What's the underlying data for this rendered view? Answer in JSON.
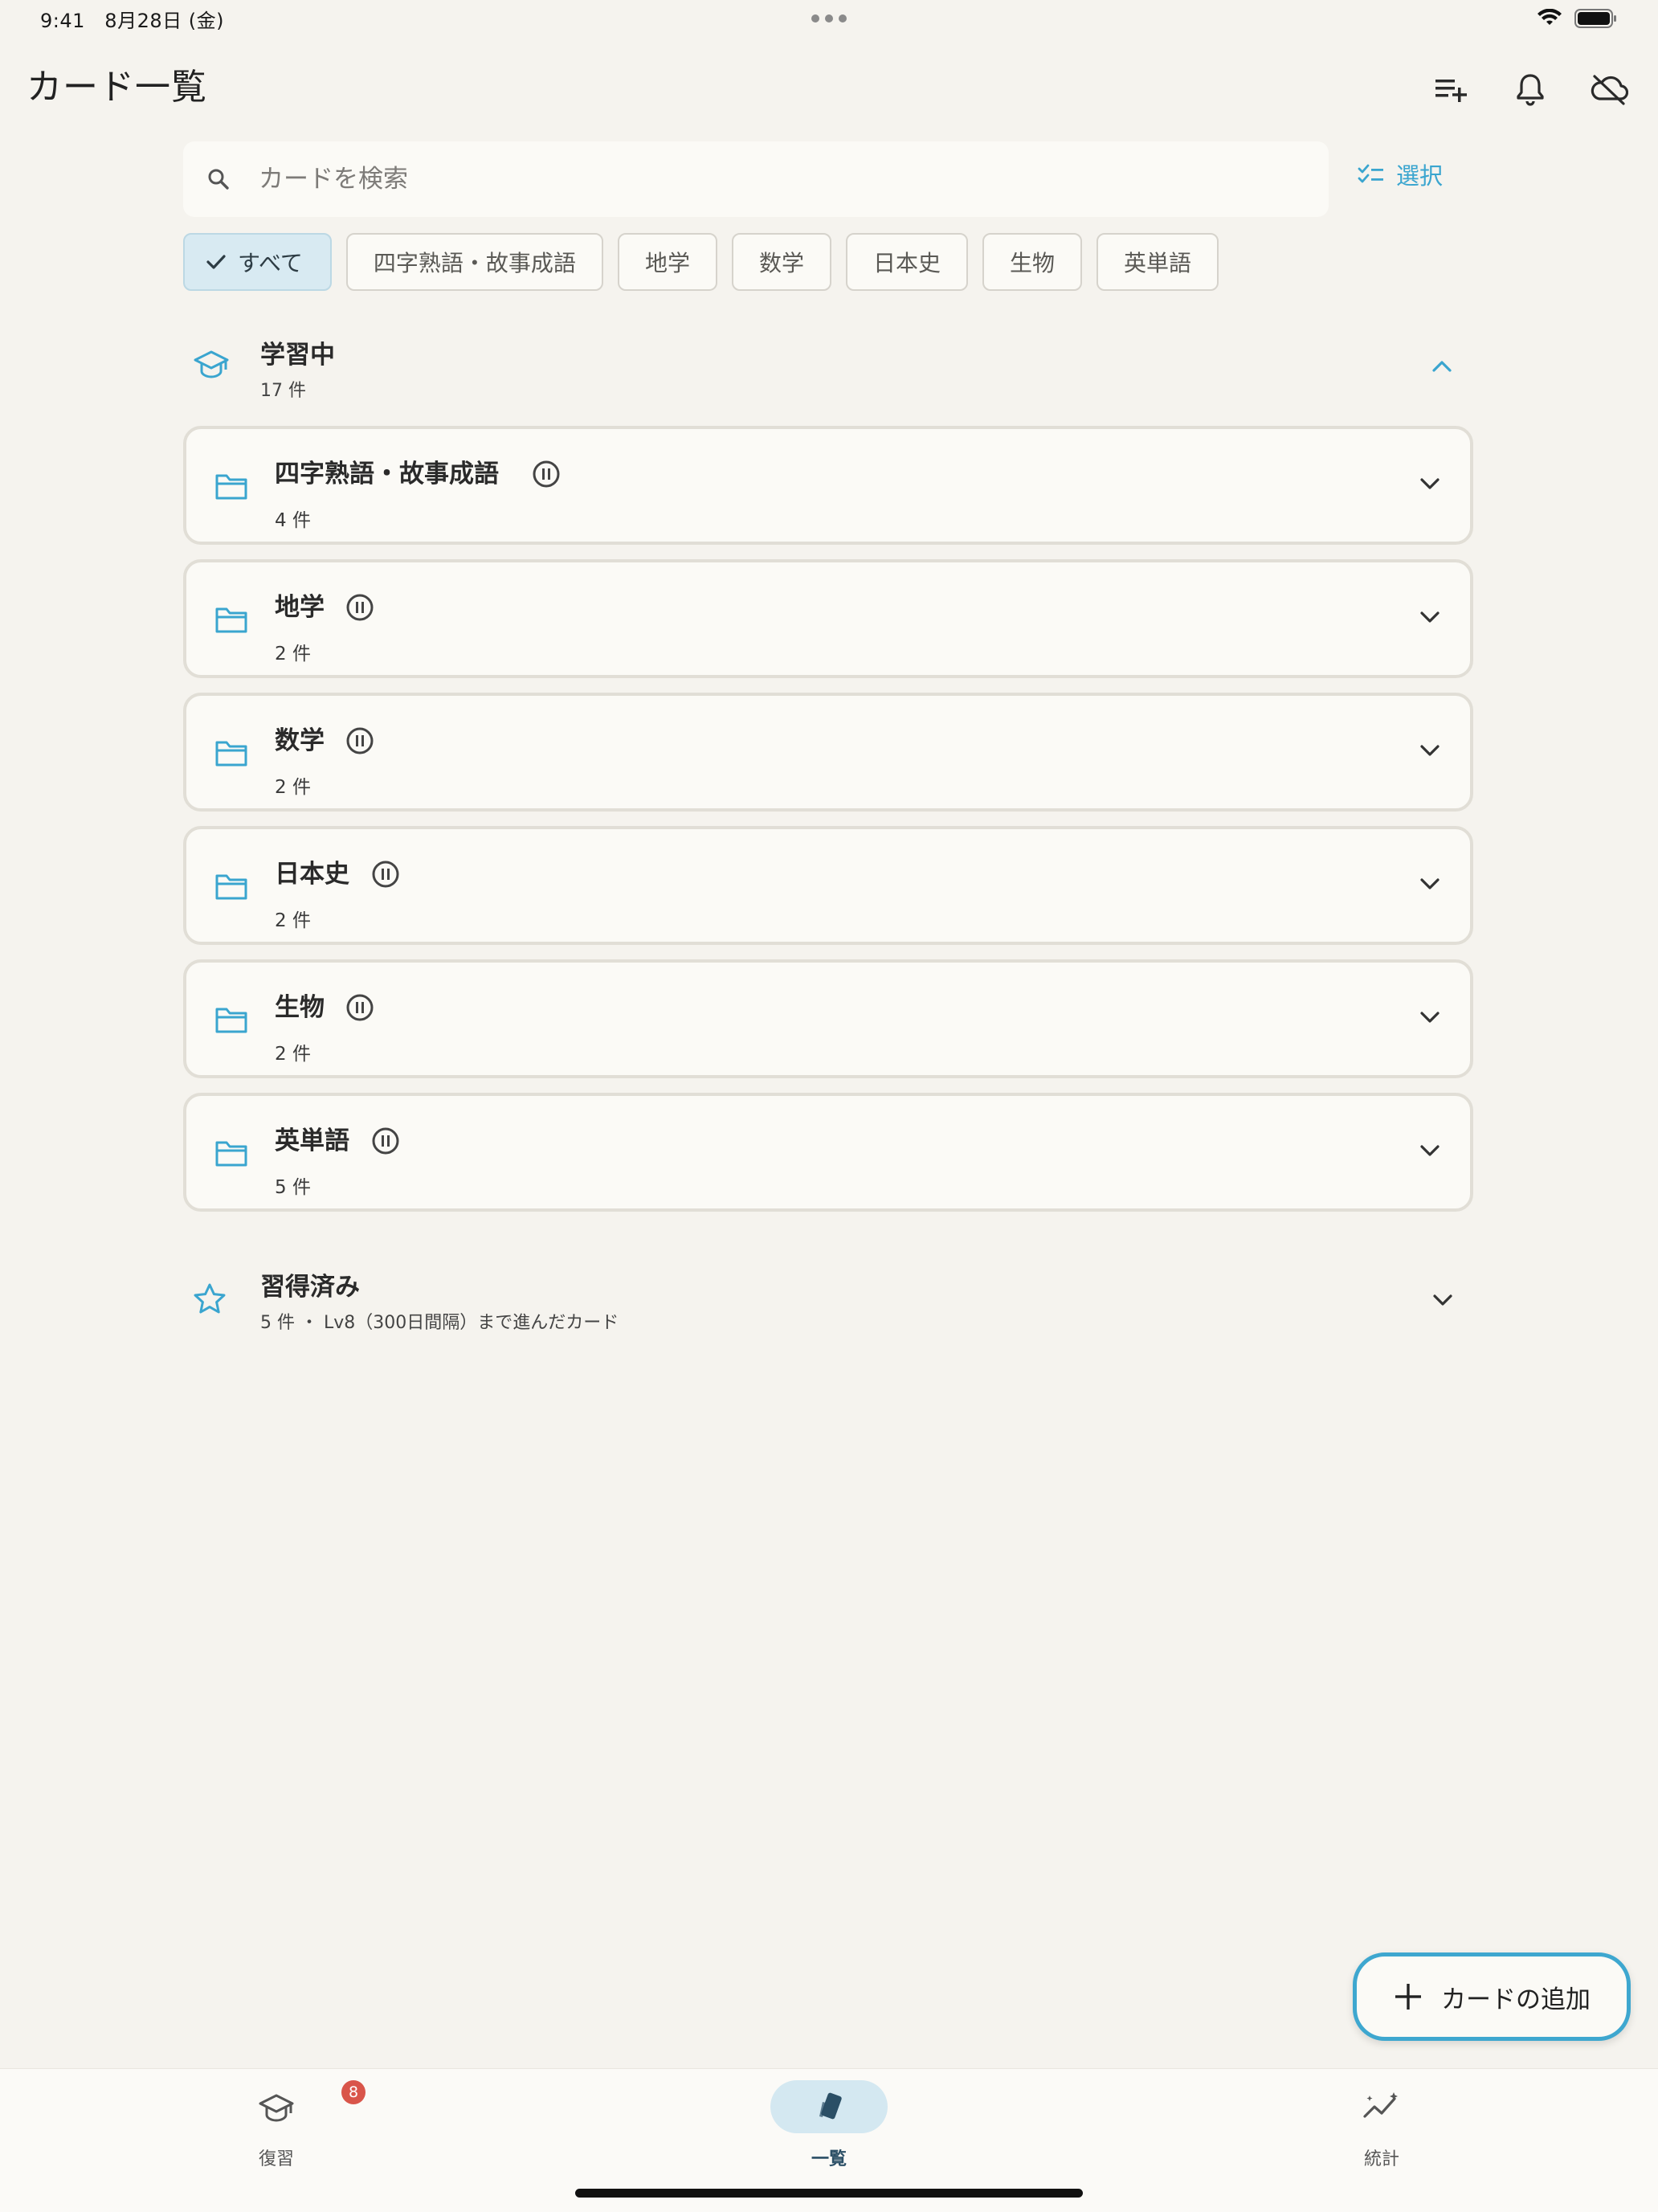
{
  "status_bar": {
    "time": "9:41",
    "date": "8月28日 (金)"
  },
  "header": {
    "title": "カード一覧",
    "actions": [
      "playlist-add-icon",
      "bell-icon",
      "cloud-off-icon"
    ]
  },
  "search": {
    "placeholder": "カードを検索",
    "select_label": "選択"
  },
  "filters": {
    "chips": [
      "すべて",
      "四字熟語・故事成語",
      "地学",
      "数学",
      "日本史",
      "生物",
      "英単語"
    ],
    "selected": "すべて"
  },
  "learning": {
    "title": "学習中",
    "count": "17 件",
    "expanded": true,
    "folders": [
      {
        "name": "四字熟語・故事成語",
        "count": "4 件",
        "paused": true
      },
      {
        "name": "地学",
        "count": "2 件",
        "paused": true
      },
      {
        "name": "数学",
        "count": "2 件",
        "paused": true
      },
      {
        "name": "日本史",
        "count": "2 件",
        "paused": true
      },
      {
        "name": "生物",
        "count": "2 件",
        "paused": true
      },
      {
        "name": "英単語",
        "count": "5 件",
        "paused": true
      }
    ]
  },
  "mastered": {
    "title": "習得済み",
    "subtitle": "5 件 ・ Lv8（300日間隔）まで進んだカード",
    "expanded": false
  },
  "fab": {
    "label": "カードの追加"
  },
  "bottom_nav": {
    "items": [
      {
        "label": "復習",
        "badge": "8",
        "icon": "graduation-cap-icon"
      },
      {
        "label": "一覧",
        "active": true,
        "icon": "cards-icon"
      },
      {
        "label": "統計",
        "icon": "stats-sparkle-icon"
      }
    ]
  },
  "colors": {
    "accent": "#3ea7cf",
    "background": "#f5f3ee",
    "card": "#fbfaf6",
    "chip_active": "#d8eaf2",
    "badge": "#d9554a"
  }
}
